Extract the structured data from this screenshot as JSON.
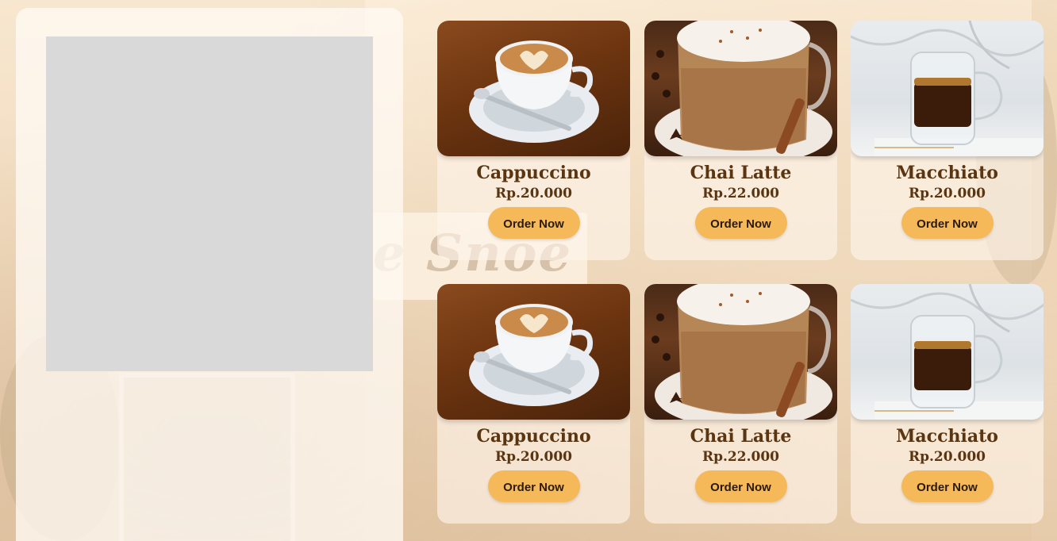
{
  "background": {
    "sign_text": "e Snoe"
  },
  "left_panel": {
    "placeholder": ""
  },
  "products": [
    {
      "name": "Cappuccino",
      "price": "Rp.20.000",
      "cta": "Order Now",
      "photo": "cappuccino"
    },
    {
      "name": "Chai Latte",
      "price": "Rp.22.000",
      "cta": "Order Now",
      "photo": "chai"
    },
    {
      "name": "Macchiato",
      "price": "Rp.20.000",
      "cta": "Order Now",
      "photo": "macchiato"
    },
    {
      "name": "Cappuccino",
      "price": "Rp.20.000",
      "cta": "Order Now",
      "photo": "cappuccino"
    },
    {
      "name": "Chai Latte",
      "price": "Rp.22.000",
      "cta": "Order Now",
      "photo": "chai"
    },
    {
      "name": "Macchiato",
      "price": "Rp.20.000",
      "cta": "Order Now",
      "photo": "macchiato"
    }
  ],
  "colors": {
    "button": "#f6b95a",
    "text_brown": "#5a3512"
  }
}
